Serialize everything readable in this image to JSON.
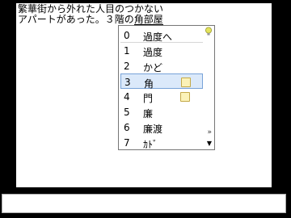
{
  "document": {
    "line1": "繁華街から外れた人目のつかない",
    "line2_prefix": "アパートがあった。３階の",
    "line2_composing": "角部屋"
  },
  "candidate_window": {
    "items": [
      {
        "num": "0",
        "text": "過度へ",
        "note": false
      },
      {
        "num": "1",
        "text": "過度",
        "note": false
      },
      {
        "num": "2",
        "text": "かど",
        "note": false
      },
      {
        "num": "3",
        "text": "角",
        "note": true
      },
      {
        "num": "4",
        "text": "門",
        "note": true
      },
      {
        "num": "5",
        "text": "廉",
        "note": false
      },
      {
        "num": "6",
        "text": "廉渡",
        "note": false
      },
      {
        "num": "7",
        "text": "ｶﾄﾞ",
        "note": false
      }
    ],
    "selected_index": 3,
    "icons": {
      "hint": "lightbulb-icon",
      "expand": "double-chevron-right-icon",
      "scroll": "triangle-down-icon"
    },
    "expand_glyph": "»",
    "scroll_glyph": "▼",
    "accent": "#78a3d8",
    "selection_bg": "#dbe9fa"
  },
  "status_bar": {
    "text": ""
  }
}
